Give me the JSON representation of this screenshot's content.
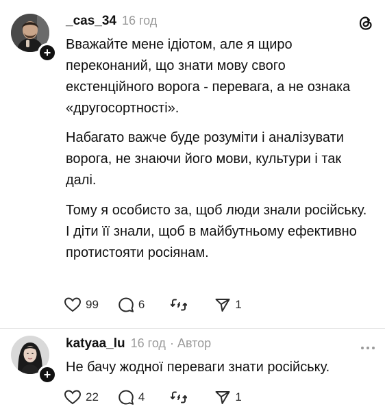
{
  "posts": [
    {
      "username": "_cas_34",
      "time": "16 год",
      "paragraphs": [
        "Вважайте мене ідіотом, але я щиро переконаний, що знати мову свого екстенційного ворога - перевага, а не ознака «другосортності».",
        "Набагато важче буде розуміти і аналізувати ворога, не знаючи його мови, культури і так далі.",
        "Тому я особисто за, щоб люди знали російську. І діти її знали, щоб в майбутньому ефективно протистояти росіянам."
      ],
      "likes": "99",
      "comments": "6",
      "reposts": "",
      "shares": "1"
    },
    {
      "username": "katyaa_lu",
      "time": "16 год",
      "author_label": "· Автор",
      "paragraphs": [
        "Не бачу жодної переваги знати російську."
      ],
      "likes": "22",
      "comments": "4",
      "reposts": "",
      "shares": "1"
    }
  ],
  "icons": {
    "threads": "threads-logo-icon",
    "like": "heart-icon",
    "comment": "comment-bubble-icon",
    "repost": "repost-icon",
    "share": "send-icon",
    "more": "more-dots-icon",
    "follow": "plus-icon"
  },
  "colors": {
    "text": "#111111",
    "muted": "#9a9a9a",
    "icon": "#2a2a2a",
    "badge": "#111111"
  }
}
